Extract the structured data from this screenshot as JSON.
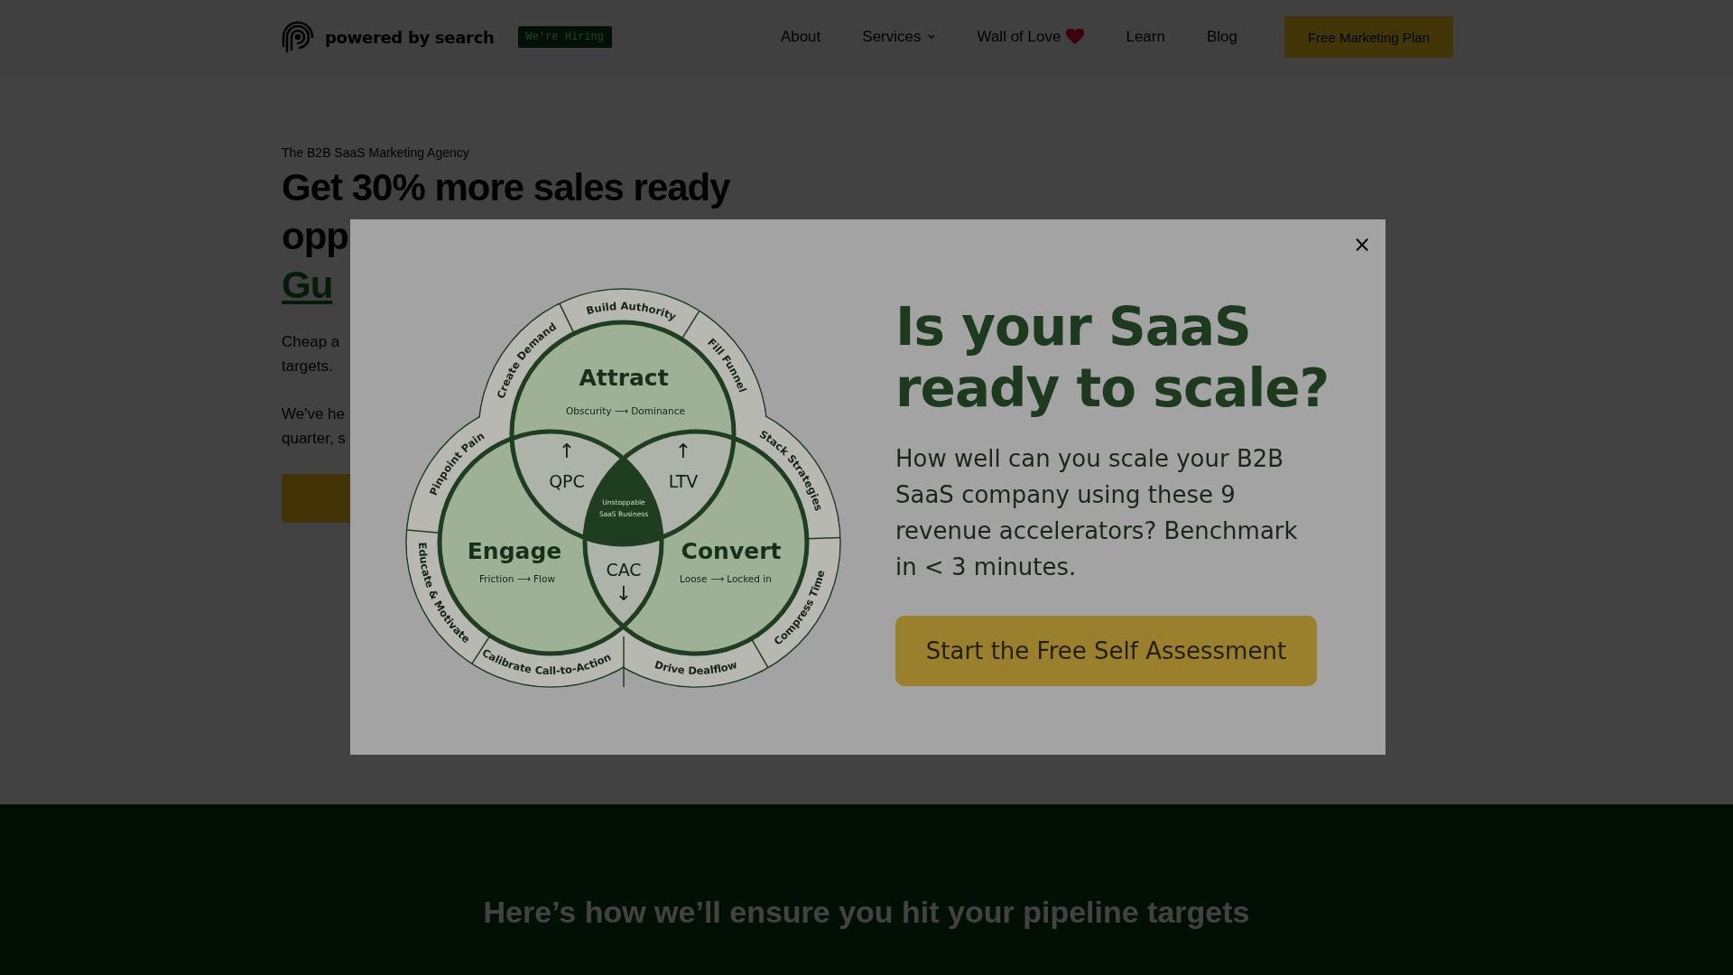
{
  "header": {
    "brand": "powered by search",
    "hiring_badge": "We're Hiring",
    "nav": [
      {
        "label": "About",
        "has_menu": false,
        "heart": false
      },
      {
        "label": "Services",
        "has_menu": true,
        "heart": false
      },
      {
        "label": "Wall of Love",
        "has_menu": false,
        "heart": true
      },
      {
        "label": "Learn",
        "has_menu": false,
        "heart": false
      },
      {
        "label": "Blog",
        "has_menu": false,
        "heart": false
      }
    ],
    "cta": "Free Marketing Plan"
  },
  "hero": {
    "tagline": "The B2B SaaS Marketing Agency",
    "headline_lines": [
      {
        "text": "Get 30% more sales ready",
        "highlight": false
      },
      {
        "text": "opp",
        "highlight": false
      },
      {
        "text": "Gu",
        "highlight": true
      }
    ],
    "paragraphs": [
      [
        "Cheap a",
        "targets."
      ],
      [
        "We've he",
        "quarter, s"
      ]
    ]
  },
  "section": {
    "heading": "Here’s how we’ll ensure you hit your pipeline targets"
  },
  "modal": {
    "close": "×",
    "heading": "Is your SaaS ready to scale?",
    "body": "How well can you scale your B2B SaaS company using these 9 revenue accelerators? Benchmark in < 3 minutes.",
    "button": "Start the Free Self Assessment",
    "diagram": {
      "circles": [
        {
          "title": "Attract",
          "subtitle": "Obscurity ⟶ Dominance"
        },
        {
          "title": "Engage",
          "subtitle": "Friction ⟶ Flow"
        },
        {
          "title": "Convert",
          "subtitle": "Loose ⟶ Locked in"
        }
      ],
      "overlaps": [
        {
          "label": "QPC",
          "arrow": "↑"
        },
        {
          "label": "LTV",
          "arrow": "↑"
        },
        {
          "label": "CAC",
          "arrow": "↓"
        }
      ],
      "center": [
        "Unstoppable",
        "SaaS Business"
      ],
      "ring_labels": [
        "Create Demand",
        "Build Authority",
        "Fill Funnel",
        "Pinpoint Pain",
        "Educate & Motivate",
        "Calibrate Call-to-Action",
        "Stack Strategies",
        "Compress Time",
        "Drive Dealflow"
      ]
    }
  }
}
